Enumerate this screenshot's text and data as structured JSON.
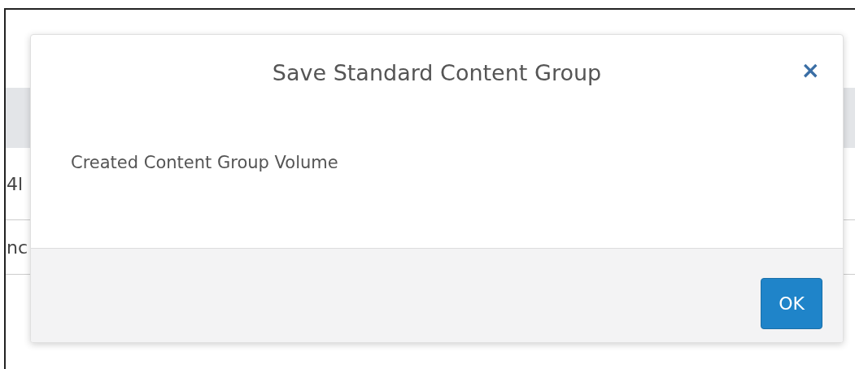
{
  "background": {
    "rows": [
      {
        "text": "4l"
      },
      {
        "text": "nc"
      }
    ]
  },
  "dialog": {
    "title": "Save Standard Content Group",
    "close": "×",
    "message": "Created Content Group Volume",
    "buttons": [
      "OK"
    ]
  }
}
